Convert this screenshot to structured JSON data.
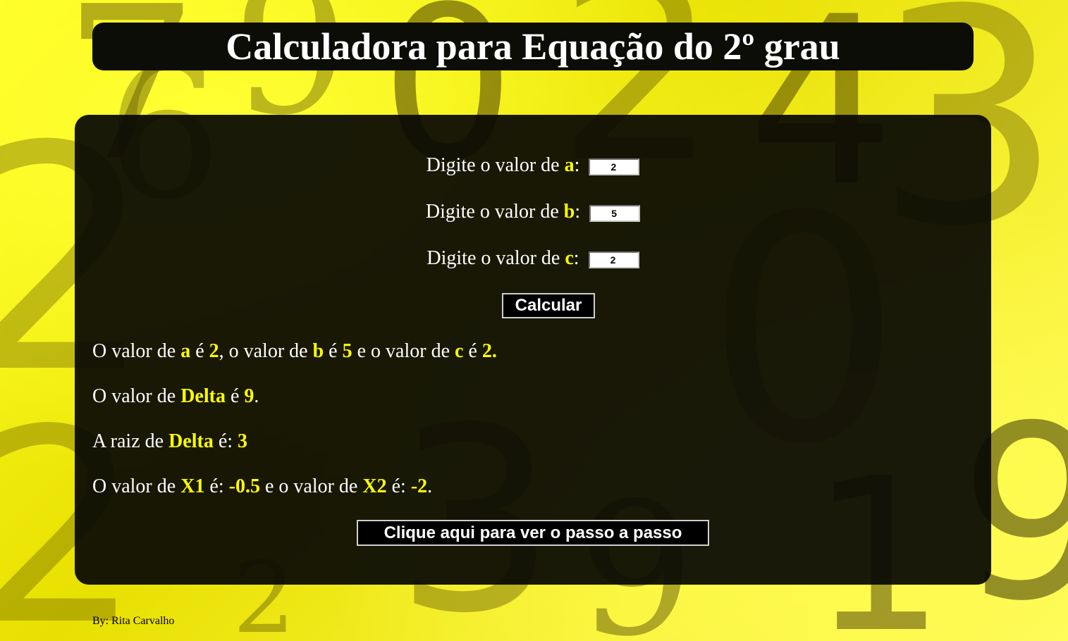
{
  "header": {
    "title": "Calculadora para Equação do 2º grau"
  },
  "form": {
    "a_label_prefix": "Digite o valor de ",
    "a_var": "a",
    "a_value": "2",
    "b_label_prefix": "Digite o valor de ",
    "b_var": "b",
    "b_value": "5",
    "c_label_prefix": "Digite o valor de ",
    "c_var": "c",
    "c_value": "2",
    "colon": ":",
    "calculate_label": "Calcular"
  },
  "results": {
    "line1": {
      "t1": "O valor de ",
      "a": "a",
      "t2": " é ",
      "a_val": "2",
      "t3": ", o valor de ",
      "b": "b",
      "t4": " é ",
      "b_val": "5",
      "t5": " e o valor de ",
      "c": "c",
      "t6": " é ",
      "c_val": "2."
    },
    "line2": {
      "t1": "O valor de ",
      "delta": "Delta",
      "t2": " é ",
      "delta_val": "9",
      "t3": "."
    },
    "line3": {
      "t1": "A raiz de ",
      "delta": "Delta",
      "t2": " é: ",
      "root_val": "3"
    },
    "line4": {
      "t1": "O valor de ",
      "x1": "X1",
      "t2": " é: ",
      "x1_val": "-0.5",
      "t3": " e o valor de ",
      "x2": "X2",
      "t4": " é: ",
      "x2_val": "-2",
      "t5": "."
    }
  },
  "step_button_label": "Clique aqui para ver o passo a passo",
  "footer": {
    "credit": "By: Rita Carvalho"
  },
  "colors": {
    "background": "#f5f000",
    "panel": "#080804",
    "highlight": "#ffff00",
    "text": "#ffffff"
  }
}
